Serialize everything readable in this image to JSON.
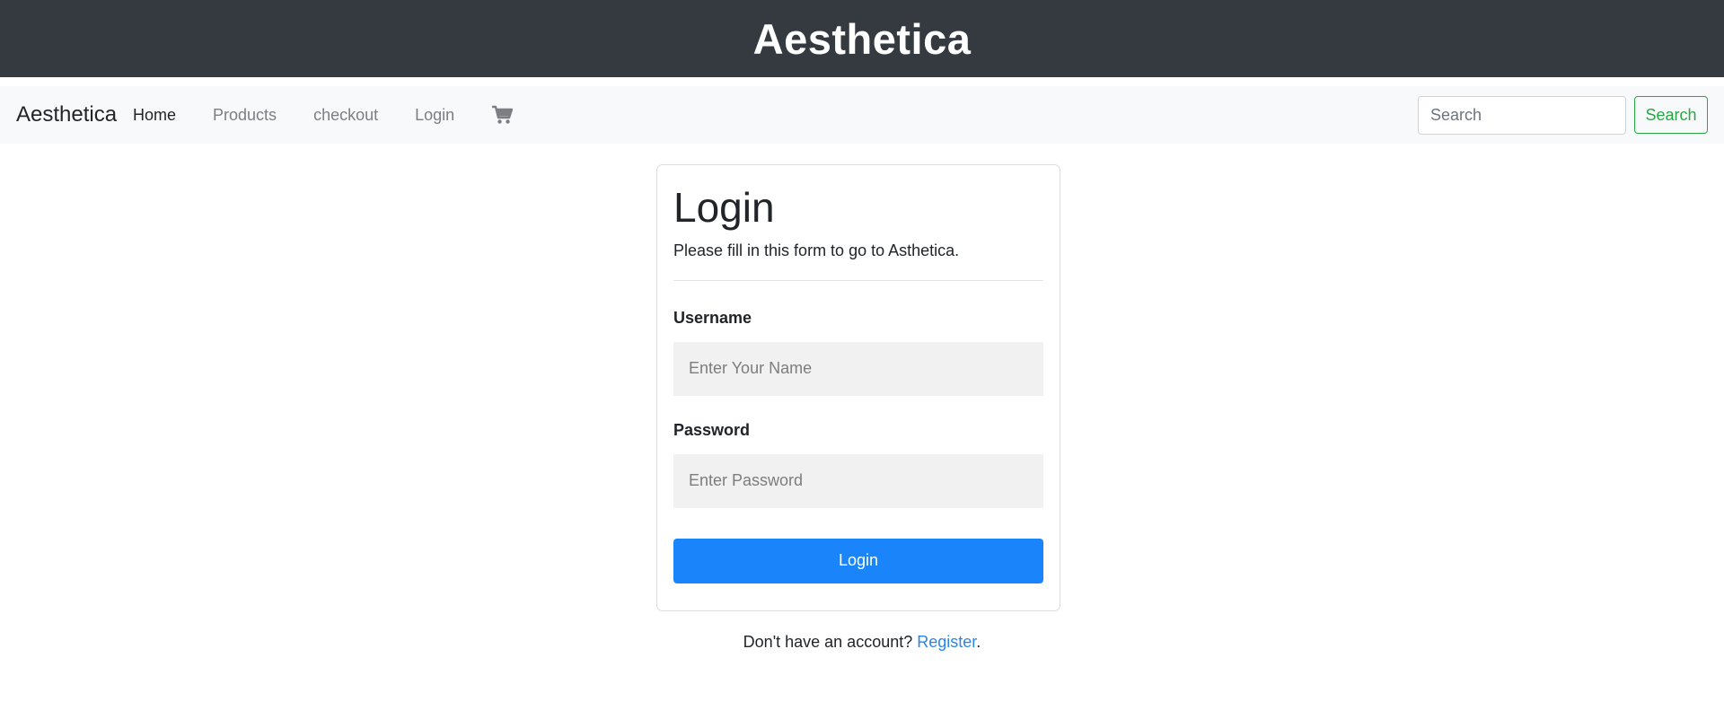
{
  "banner": {
    "title": "Aesthetica"
  },
  "navbar": {
    "brand": "Aesthetica",
    "links": [
      {
        "label": "Home",
        "active": true
      },
      {
        "label": "Products",
        "active": false
      },
      {
        "label": "checkout",
        "active": false
      },
      {
        "label": "Login",
        "active": false
      }
    ],
    "cart_icon": "shopping-cart-icon",
    "search": {
      "placeholder": "Search",
      "value": "",
      "button_label": "Search"
    }
  },
  "login_form": {
    "title": "Login",
    "subtitle": "Please fill in this form to go to Asthetica.",
    "username": {
      "label": "Username",
      "placeholder": "Enter Your Name",
      "value": ""
    },
    "password": {
      "label": "Password",
      "placeholder": "Enter Password",
      "value": ""
    },
    "submit_label": "Login"
  },
  "register": {
    "prompt": "Don't have an account? ",
    "link_label": "Register",
    "suffix": "."
  },
  "colors": {
    "banner_bg": "#343a40",
    "navbar_bg": "#f8f9fa",
    "primary": "#1a85fb",
    "success": "#28a745",
    "link": "#2a85e8"
  }
}
